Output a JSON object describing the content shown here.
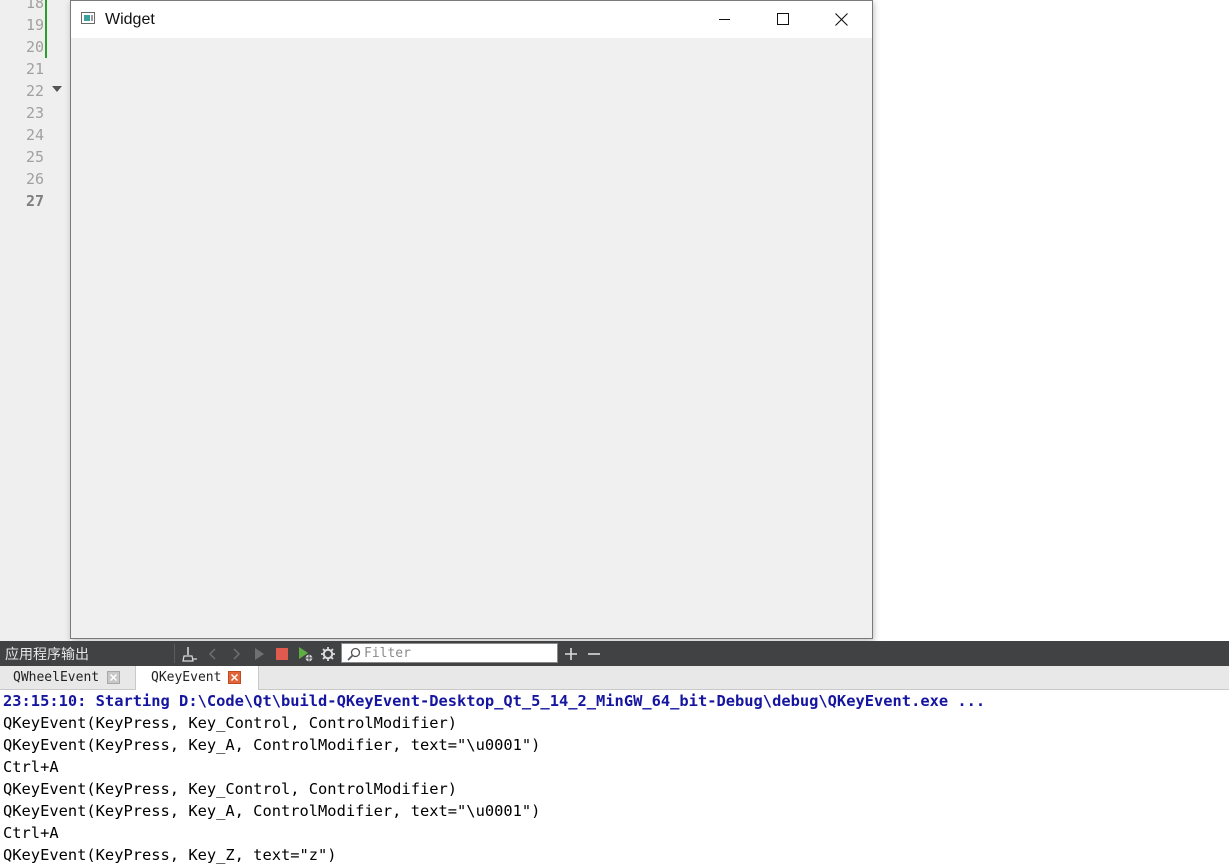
{
  "editor": {
    "line_numbers": [
      "18",
      "19",
      "20",
      "21",
      "22",
      "23",
      "24",
      "25",
      "26",
      "27"
    ],
    "current_line": "27"
  },
  "window": {
    "title": "Widget"
  },
  "output_pane": {
    "title": "应用程序输出",
    "filter_placeholder": "Filter",
    "toolbar_icons": [
      "clean-output-icon",
      "previous-item-icon",
      "next-item-icon",
      "run-icon",
      "stop-icon",
      "debug-run-icon",
      "settings-icon",
      "zoom-in-icon",
      "zoom-out-icon"
    ]
  },
  "tabs": [
    {
      "label": "QWheelEvent",
      "active": false
    },
    {
      "label": "QKeyEvent",
      "active": true
    }
  ],
  "output_lines": [
    {
      "text": "23:15:10: Starting D:\\Code\\Qt\\build-QKeyEvent-Desktop_Qt_5_14_2_MinGW_64_bit-Debug\\debug\\QKeyEvent.exe ...",
      "kind": "status"
    },
    {
      "text": "QKeyEvent(KeyPress, Key_Control, ControlModifier)",
      "kind": "normal"
    },
    {
      "text": "QKeyEvent(KeyPress, Key_A, ControlModifier, text=\"\\u0001\")",
      "kind": "normal"
    },
    {
      "text": "Ctrl+A",
      "kind": "normal"
    },
    {
      "text": "QKeyEvent(KeyPress, Key_Control, ControlModifier)",
      "kind": "normal"
    },
    {
      "text": "QKeyEvent(KeyPress, Key_A, ControlModifier, text=\"\\u0001\")",
      "kind": "normal"
    },
    {
      "text": "Ctrl+A",
      "kind": "normal"
    },
    {
      "text": "QKeyEvent(KeyPress, Key_Z, text=\"z\")",
      "kind": "normal"
    }
  ],
  "colors": {
    "status_text": "#1515a0",
    "toolbar_bg": "#404244",
    "active_tab_close": "#e2643a",
    "change_marker": "#2a9d2a"
  }
}
